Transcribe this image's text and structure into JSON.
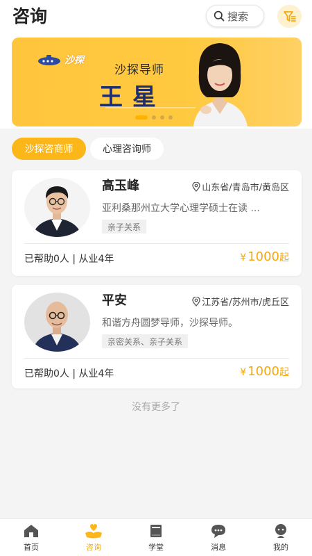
{
  "header": {
    "title": "咨询",
    "search_label": "搜索"
  },
  "banner": {
    "logo_text": "沙探",
    "subtitle": "沙探导师",
    "name": "王星",
    "slides": 4,
    "active_slide": 0
  },
  "tabs": [
    {
      "label": "沙探咨商师",
      "active": true
    },
    {
      "label": "心理咨询师",
      "active": false
    }
  ],
  "counselors": [
    {
      "name": "高玉峰",
      "location": "山东省/青岛市/黄岛区",
      "description": "亚利桑那州立大学心理学硕士在读 ...",
      "tags": "亲子关系",
      "stats": "已帮助0人 | 从业4年",
      "price_symbol": "¥",
      "price": "1000",
      "price_suffix": "起"
    },
    {
      "name": "平安",
      "location": "江苏省/苏州市/虎丘区",
      "description": "和谐方舟圆梦导师，沙探导师。",
      "tags": "亲密关系、亲子关系",
      "stats": "已帮助0人 | 从业4年",
      "price_symbol": "¥",
      "price": "1000",
      "price_suffix": "起"
    }
  ],
  "list_end_text": "没有更多了",
  "nav": [
    {
      "label": "首页",
      "icon": "home-icon",
      "active": false
    },
    {
      "label": "咨询",
      "icon": "consult-icon",
      "active": true
    },
    {
      "label": "学堂",
      "icon": "book-icon",
      "active": false
    },
    {
      "label": "消息",
      "icon": "message-icon",
      "active": false
    },
    {
      "label": "我的",
      "icon": "profile-icon",
      "active": false
    }
  ],
  "colors": {
    "accent": "#fbb719",
    "price": "#f3a90e",
    "banner": "#ffc63d",
    "name_blue": "#1f2e6e"
  }
}
